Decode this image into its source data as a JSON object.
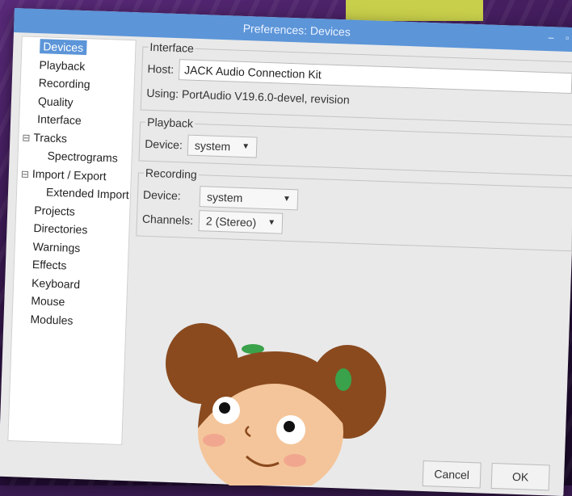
{
  "window": {
    "title": "Preferences: Devices"
  },
  "sidebar": {
    "items": [
      {
        "label": "Devices",
        "level": 1,
        "selected": true
      },
      {
        "label": "Playback",
        "level": 1
      },
      {
        "label": "Recording",
        "level": 1
      },
      {
        "label": "Quality",
        "level": 1
      },
      {
        "label": "Interface",
        "level": 1
      },
      {
        "label": "Tracks",
        "level": 0,
        "toggle": "⊟"
      },
      {
        "label": "Spectrograms",
        "level": 2
      },
      {
        "label": "Import / Export",
        "level": 0,
        "toggle": "⊟"
      },
      {
        "label": "Extended Import",
        "level": 2
      },
      {
        "label": "Projects",
        "level": 1
      },
      {
        "label": "Directories",
        "level": 1
      },
      {
        "label": "Warnings",
        "level": 1
      },
      {
        "label": "Effects",
        "level": 1
      },
      {
        "label": "Keyboard",
        "level": 1
      },
      {
        "label": "Mouse",
        "level": 1
      },
      {
        "label": "Modules",
        "level": 1
      }
    ]
  },
  "interface": {
    "legend": "Interface",
    "host_label": "Host:",
    "host_value": "JACK Audio Connection Kit",
    "using_text": "Using: PortAudio V19.6.0-devel, revision"
  },
  "playback": {
    "legend": "Playback",
    "device_label": "Device:",
    "device_value": "system"
  },
  "recording": {
    "legend": "Recording",
    "device_label": "Device:",
    "device_value": "system",
    "channels_label": "Channels:",
    "channels_value": "2 (Stereo)"
  },
  "buttons": {
    "cancel": "Cancel",
    "ok": "OK"
  }
}
